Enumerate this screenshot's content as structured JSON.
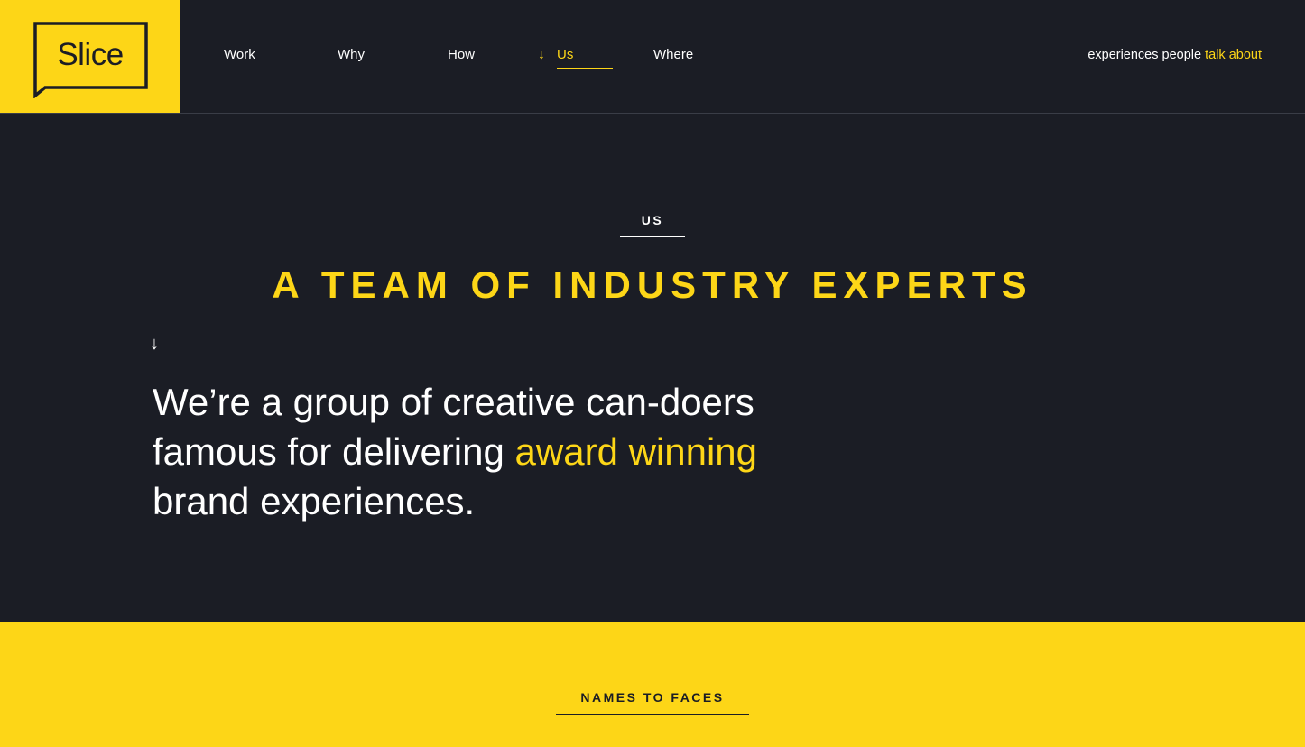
{
  "brand": {
    "logo_text": "Slice",
    "accent_color": "#fdd617",
    "background_color": "#1b1d25"
  },
  "nav": {
    "items": [
      {
        "label": "Work",
        "active": false
      },
      {
        "label": "Why",
        "active": false
      },
      {
        "label": "How",
        "active": false
      },
      {
        "label": "Us",
        "active": true
      },
      {
        "label": "Where",
        "active": false
      }
    ],
    "active_indicator_icon": "arrow-down-icon",
    "active_indicator_glyph": "↓"
  },
  "tagline": {
    "prefix": "experiences people ",
    "highlight": "talk about"
  },
  "hero": {
    "eyebrow": "US",
    "headline": "A TEAM OF INDUSTRY EXPERTS",
    "arrow_glyph": "↓",
    "intro_line1": "We’re a group of creative can-doers",
    "intro_line2_prefix": "famous for delivering ",
    "intro_line2_highlight": "award winning",
    "intro_line3": "brand experiences."
  },
  "names_section": {
    "label": "NAMES TO FACES"
  }
}
